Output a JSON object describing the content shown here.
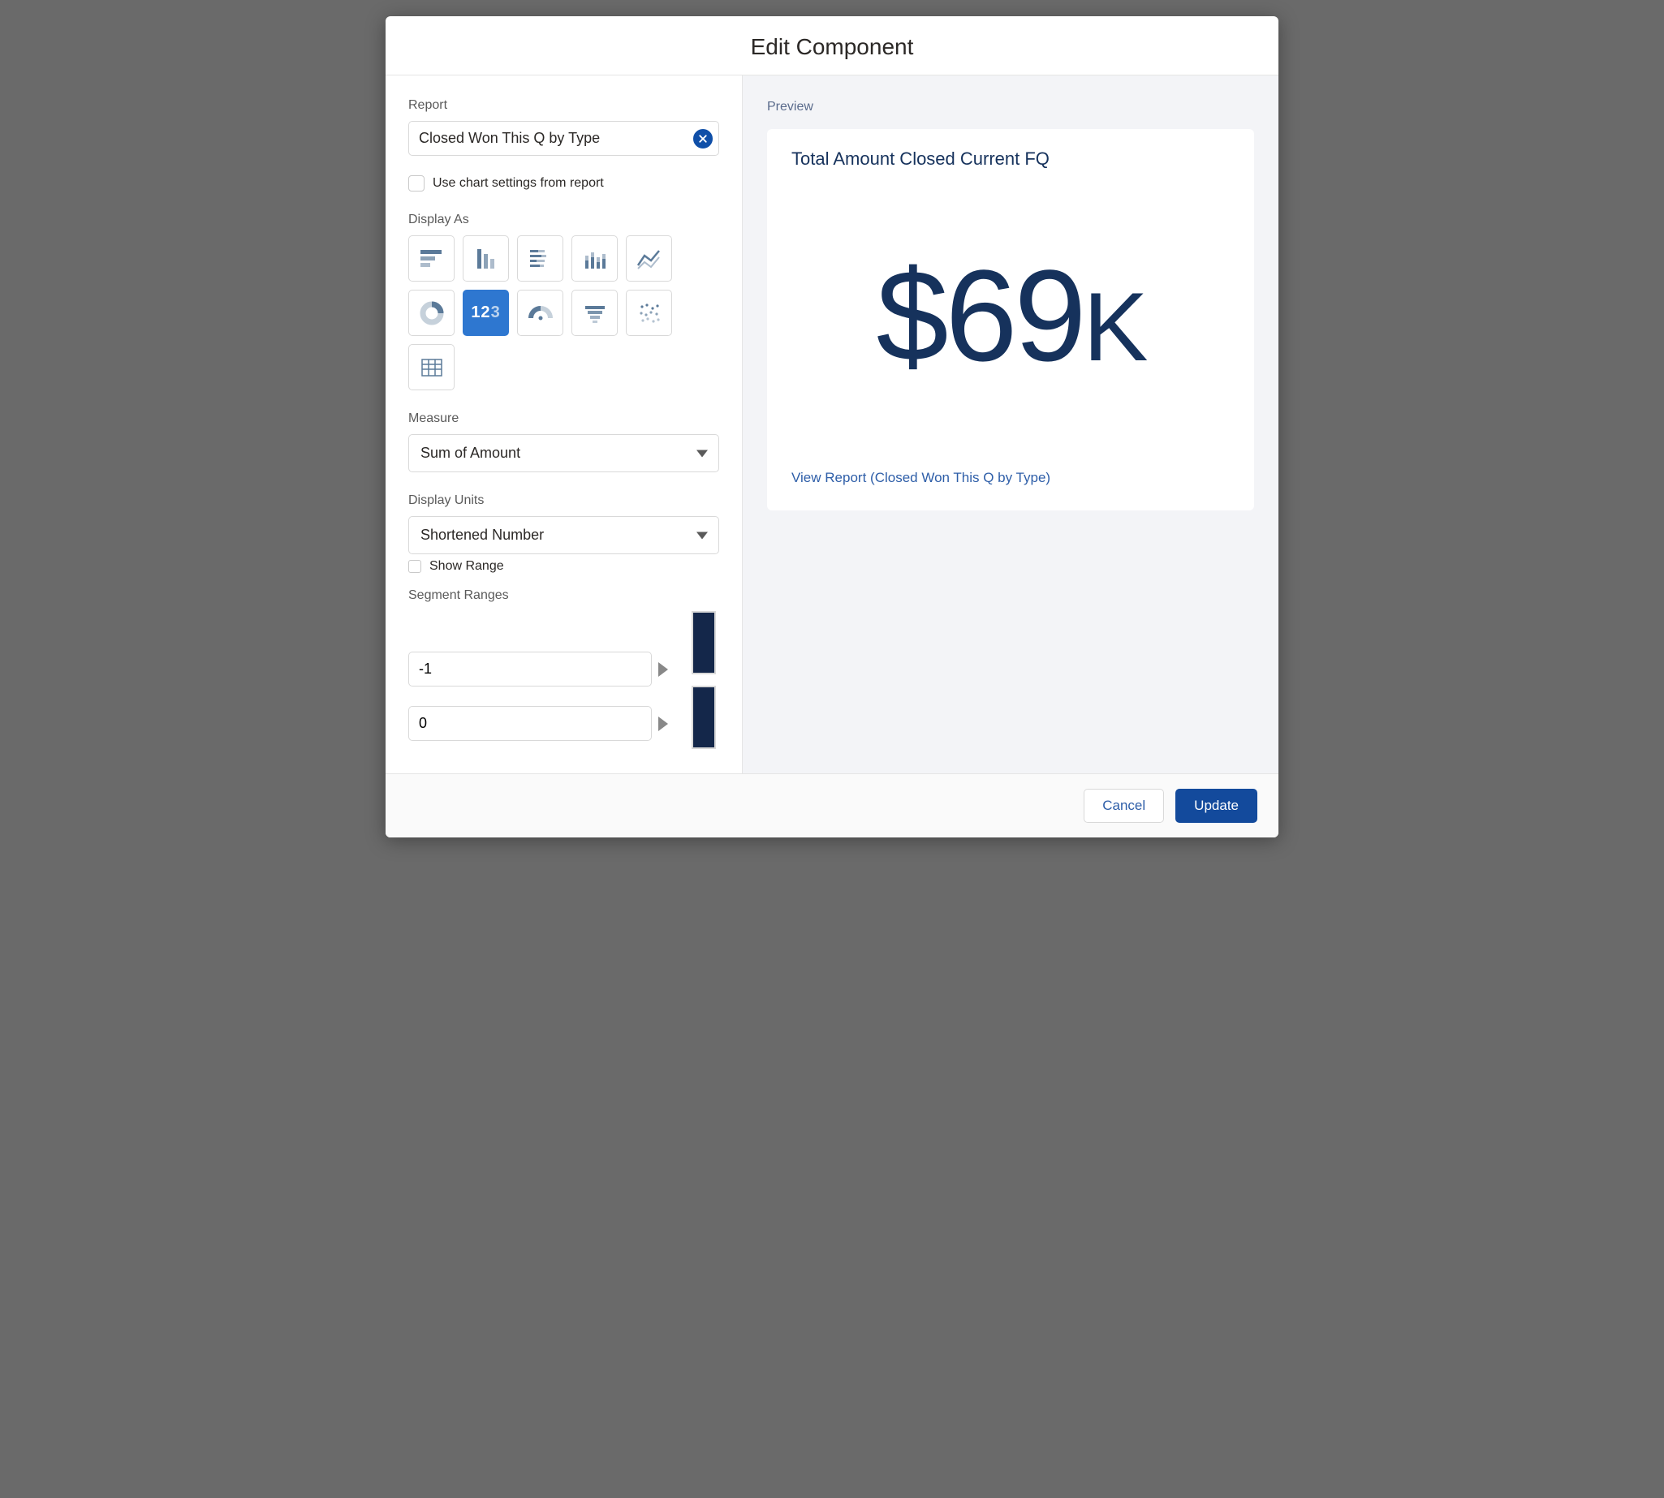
{
  "modal": {
    "title": "Edit Component"
  },
  "left": {
    "report_label": "Report",
    "report_value": "Closed Won This Q by Type",
    "use_chart_settings_label": "Use chart settings from report",
    "display_as_label": "Display As",
    "chart_types": [
      {
        "name": "horizontal-bar-icon"
      },
      {
        "name": "vertical-bar-icon"
      },
      {
        "name": "stacked-bar-icon"
      },
      {
        "name": "stacked-column-icon"
      },
      {
        "name": "line-icon"
      },
      {
        "name": "donut-icon"
      },
      {
        "name": "metric-icon",
        "label": "123",
        "selected": true
      },
      {
        "name": "gauge-icon"
      },
      {
        "name": "funnel-icon"
      },
      {
        "name": "scatter-icon"
      },
      {
        "name": "table-icon"
      }
    ],
    "measure_label": "Measure",
    "measure_value": "Sum of Amount",
    "display_units_label": "Display Units",
    "display_units_value": "Shortened Number",
    "show_range_label": "Show Range",
    "segment_ranges_label": "Segment Ranges",
    "segments": [
      {
        "value": "-1",
        "color": "#14274a"
      },
      {
        "value": "0",
        "color": "#14274a"
      }
    ]
  },
  "preview": {
    "section_label": "Preview",
    "card_title": "Total Amount Closed Current FQ",
    "metric_prefix": "$",
    "metric_number": "69",
    "metric_suffix": "K",
    "view_report_prefix": "View Report (",
    "view_report_name": "Closed Won This Q by Type",
    "view_report_suffix": ")"
  },
  "footer": {
    "cancel": "Cancel",
    "update": "Update"
  }
}
